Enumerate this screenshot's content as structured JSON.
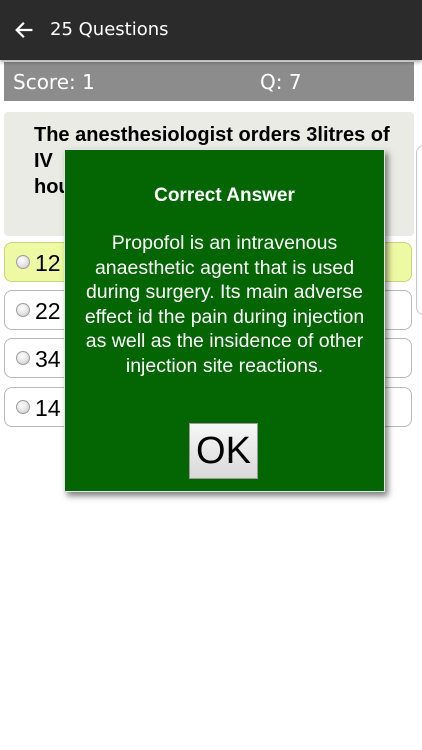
{
  "appbar": {
    "back_icon": "arrow-left-icon",
    "title": "25 Questions"
  },
  "scorebar": {
    "score": "Score: 1",
    "question_number": "Q: 7"
  },
  "question": {
    "text_line1": "The anesthesiologist orders 3litres of",
    "text_line2": "IV",
    "text_line3": "hou"
  },
  "options": [
    {
      "label": "12",
      "selected": true
    },
    {
      "label": "22",
      "selected": false
    },
    {
      "label": "34",
      "selected": false
    },
    {
      "label": "14",
      "selected": false
    }
  ],
  "dialog": {
    "title": "Correct Answer",
    "message": "Propofol is an intravenous anaesthetic agent that is used during surgery. Its main adverse effect id the pain during injection as well as the insidence of other injection site reactions.",
    "ok_label": "OK"
  },
  "colors": {
    "appbar": "#2b2b2b",
    "scorebar": "#8c8c8c",
    "question_card": "#e9ebe4",
    "selected_option": "#eefaa3",
    "dialog": "#036603"
  }
}
